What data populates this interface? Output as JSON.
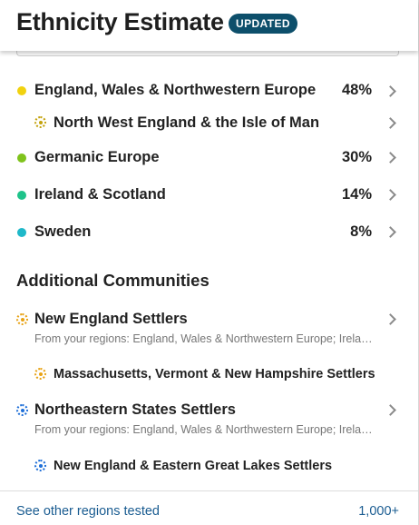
{
  "header": {
    "title": "Ethnicity Estimate",
    "badge": "UPDATED"
  },
  "regions": [
    {
      "name": "England, Wales & Northwestern Europe",
      "percent": "48%",
      "color": "#f1d20f"
    },
    {
      "name": "North West England & the Isle of Man",
      "sub": true,
      "color": "#c3a20d"
    },
    {
      "name": "Germanic Europe",
      "percent": "30%",
      "color": "#7fc31c"
    },
    {
      "name": "Ireland & Scotland",
      "percent": "14%",
      "color": "#1fc38a"
    },
    {
      "name": "Sweden",
      "percent": "8%",
      "color": "#1fb8c9"
    }
  ],
  "additional": {
    "title": "Additional Communities",
    "communities": [
      {
        "name": "New England Settlers",
        "regions_text": "From your regions: England, Wales & Northwestern Europe; Ireland & Scotland",
        "color": "#e8a316",
        "sub": "Massachusetts, Vermont & New Hampshire Settlers"
      },
      {
        "name": "Northeastern States Settlers",
        "regions_text": "From your regions: England, Wales & Northwestern Europe; Ireland & Scotland",
        "color": "#1f6fd8",
        "sub": "New England & Eastern Great Lakes Settlers"
      }
    ]
  },
  "footer": {
    "link": "See other regions tested",
    "count": "1,000+"
  }
}
